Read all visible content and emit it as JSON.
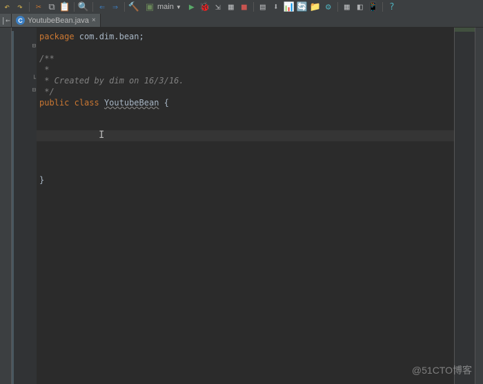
{
  "toolbar": {
    "run_config": "main"
  },
  "tab": {
    "filename": "YoutubeBean.java",
    "icon_letter": "C"
  },
  "code": {
    "l1_kw": "package",
    "l1_pkg": " com.dim.bean",
    "l1_semi": ";",
    "l2": "/**",
    "l3": " *",
    "l4": " * Created by dim on 16/3/16.",
    "l5": " */",
    "l6_kw1": "public",
    "l6_kw2": "class",
    "l6_cls": "YoutubeBean",
    "l6_brace": " {",
    "l_close": "}"
  },
  "watermark": "@51CTO博客"
}
